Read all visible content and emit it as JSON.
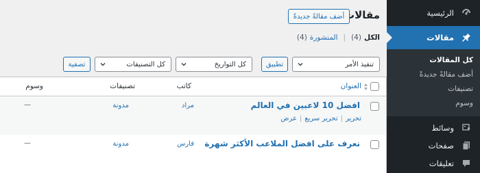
{
  "menu": {
    "dashboard_label": "الرئيسية",
    "posts_label": "مقالات",
    "posts_submenu": [
      "كل المقالات",
      "أضف مقالةً جديدةً",
      "تصنيفات",
      "وسوم"
    ],
    "media_label": "وسائط",
    "pages_label": "صفحات",
    "comments_label": "تعليقات",
    "accent_color": "#2271b1",
    "bg_color": "#1d2327"
  },
  "header": {
    "title": "مقالات",
    "add_new_label": "أضف مقالةً جديدةً"
  },
  "views": {
    "all_label": "الكل",
    "all_count": "(4)",
    "published_label": "المنشورة",
    "published_count": "(4)",
    "separator": "|"
  },
  "filters": {
    "bulk_action": "تنفيذ الأمر",
    "apply_label": "تطبيق",
    "dates": "كل التواريخ",
    "categories": "كل التصنيفات",
    "filter_label": "تصفية"
  },
  "table": {
    "columns": {
      "title": "العنوان",
      "author": "كاتب",
      "categories": "تصنيفات",
      "tags": "وسوم"
    },
    "rows": [
      {
        "title": "افضل 10 لاعبين في العالم",
        "author": "مراد",
        "category": "مدونة",
        "tags": "—",
        "actions": [
          "تحرير",
          "تحرير سريع",
          "عرض"
        ]
      },
      {
        "title": "نعرف على افضل الملاعب الأكثر شهرة",
        "author": "فارس",
        "category": "مدونة",
        "tags": "—"
      }
    ]
  }
}
